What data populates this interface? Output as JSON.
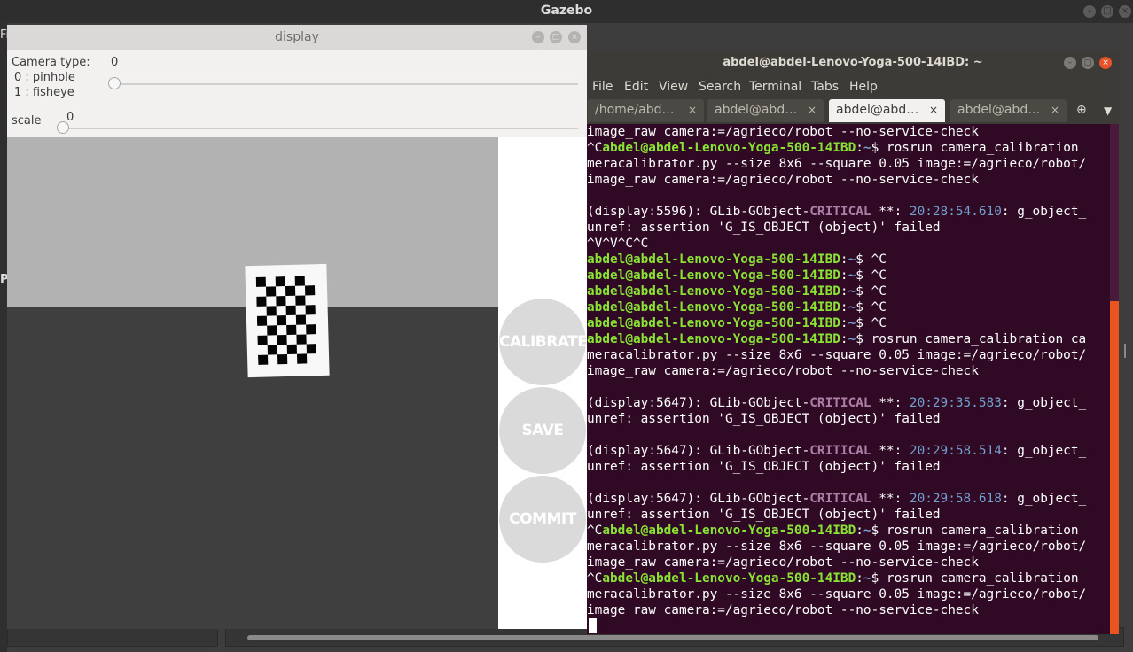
{
  "gazebo": {
    "title": "Gazebo",
    "left_letter_top": "Fi",
    "left_letter_mid": "P"
  },
  "display": {
    "title": "display",
    "camera_type_label": "Camera type:",
    "camera_type_value": "0",
    "options": [
      "0 : pinhole",
      "1 : fisheye"
    ],
    "camera_type_level": 0,
    "scale_label": "scale",
    "scale_value": "0",
    "scale_level": 0,
    "buttons": {
      "calibrate": "CALIBRATE",
      "save": "SAVE",
      "commit": "COMMIT"
    },
    "colors": {
      "sky": "#b2b2b2",
      "ground": "#3f3f3f",
      "button": "#dadada"
    }
  },
  "terminal": {
    "title": "abdel@abdel-Lenovo-Yoga-500-14IBD: ~",
    "menu": [
      "File",
      "Edit",
      "View",
      "Search",
      "Terminal",
      "Tabs",
      "Help"
    ],
    "tabs": [
      {
        "label": "/home/abd…",
        "close": "×"
      },
      {
        "label": "abdel@abd…",
        "close": "×"
      },
      {
        "label": "abdel@abd…",
        "close": "×",
        "active": true
      },
      {
        "label": "abdel@abd…",
        "close": "×"
      }
    ],
    "colors": {
      "background": "#300a24",
      "prompt": "#8ae234",
      "path": "#729fcf",
      "critical": "#ad7fa8",
      "scrollbar": "#e95420"
    },
    "lines": [
      [
        [
          "t",
          "image_raw camera:=/agrieco/robot --no-service-check"
        ]
      ],
      [
        [
          "t",
          "^C"
        ],
        [
          "g",
          "abdel@abdel-Lenovo-Yoga-500-14IBD"
        ],
        [
          "t",
          ":"
        ],
        [
          "b",
          "~"
        ],
        [
          "t",
          "$ rosrun camera_calibration "
        ]
      ],
      [
        [
          "t",
          "meracalibrator.py --size 8x6 --square 0.05 image:=/agrieco/robot/"
        ]
      ],
      [
        [
          "t",
          "image_raw camera:=/agrieco/robot --no-service-check"
        ]
      ],
      [
        [
          "t",
          ""
        ]
      ],
      [
        [
          "t",
          "(display:5596): GLib-GObject-"
        ],
        [
          "m",
          "CRITICAL"
        ],
        [
          "t",
          " **: "
        ],
        [
          "bl",
          "20:28:54.610"
        ],
        [
          "t",
          ": g_object_"
        ]
      ],
      [
        [
          "t",
          "unref: assertion 'G_IS_OBJECT (object)' failed"
        ]
      ],
      [
        [
          "t",
          "^V^V^C^C"
        ]
      ],
      [
        [
          "g",
          "abdel@abdel-Lenovo-Yoga-500-14IBD"
        ],
        [
          "t",
          ":"
        ],
        [
          "b",
          "~"
        ],
        [
          "t",
          "$ ^C"
        ]
      ],
      [
        [
          "g",
          "abdel@abdel-Lenovo-Yoga-500-14IBD"
        ],
        [
          "t",
          ":"
        ],
        [
          "b",
          "~"
        ],
        [
          "t",
          "$ ^C"
        ]
      ],
      [
        [
          "g",
          "abdel@abdel-Lenovo-Yoga-500-14IBD"
        ],
        [
          "t",
          ":"
        ],
        [
          "b",
          "~"
        ],
        [
          "t",
          "$ ^C"
        ]
      ],
      [
        [
          "g",
          "abdel@abdel-Lenovo-Yoga-500-14IBD"
        ],
        [
          "t",
          ":"
        ],
        [
          "b",
          "~"
        ],
        [
          "t",
          "$ ^C"
        ]
      ],
      [
        [
          "g",
          "abdel@abdel-Lenovo-Yoga-500-14IBD"
        ],
        [
          "t",
          ":"
        ],
        [
          "b",
          "~"
        ],
        [
          "t",
          "$ ^C"
        ]
      ],
      [
        [
          "g",
          "abdel@abdel-Lenovo-Yoga-500-14IBD"
        ],
        [
          "t",
          ":"
        ],
        [
          "b",
          "~"
        ],
        [
          "t",
          "$ rosrun camera_calibration ca"
        ]
      ],
      [
        [
          "t",
          "meracalibrator.py --size 8x6 --square 0.05 image:=/agrieco/robot/"
        ]
      ],
      [
        [
          "t",
          "image_raw camera:=/agrieco/robot --no-service-check"
        ]
      ],
      [
        [
          "t",
          ""
        ]
      ],
      [
        [
          "t",
          "(display:5647): GLib-GObject-"
        ],
        [
          "m",
          "CRITICAL"
        ],
        [
          "t",
          " **: "
        ],
        [
          "bl",
          "20:29:35.583"
        ],
        [
          "t",
          ": g_object_"
        ]
      ],
      [
        [
          "t",
          "unref: assertion 'G_IS_OBJECT (object)' failed"
        ]
      ],
      [
        [
          "t",
          ""
        ]
      ],
      [
        [
          "t",
          "(display:5647): GLib-GObject-"
        ],
        [
          "m",
          "CRITICAL"
        ],
        [
          "t",
          " **: "
        ],
        [
          "bl",
          "20:29:58.514"
        ],
        [
          "t",
          ": g_object_"
        ]
      ],
      [
        [
          "t",
          "unref: assertion 'G_IS_OBJECT (object)' failed"
        ]
      ],
      [
        [
          "t",
          ""
        ]
      ],
      [
        [
          "t",
          "(display:5647): GLib-GObject-"
        ],
        [
          "m",
          "CRITICAL"
        ],
        [
          "t",
          " **: "
        ],
        [
          "bl",
          "20:29:58.618"
        ],
        [
          "t",
          ": g_object_"
        ]
      ],
      [
        [
          "t",
          "unref: assertion 'G_IS_OBJECT (object)' failed"
        ]
      ],
      [
        [
          "t",
          "^C"
        ],
        [
          "g",
          "abdel@abdel-Lenovo-Yoga-500-14IBD"
        ],
        [
          "t",
          ":"
        ],
        [
          "b",
          "~"
        ],
        [
          "t",
          "$ rosrun camera_calibration "
        ]
      ],
      [
        [
          "t",
          "meracalibrator.py --size 8x6 --square 0.05 image:=/agrieco/robot/"
        ]
      ],
      [
        [
          "t",
          "image_raw camera:=/agrieco/robot --no-service-check"
        ]
      ],
      [
        [
          "t",
          "^C"
        ],
        [
          "g",
          "abdel@abdel-Lenovo-Yoga-500-14IBD"
        ],
        [
          "t",
          ":"
        ],
        [
          "b",
          "~"
        ],
        [
          "t",
          "$ rosrun camera_calibration "
        ]
      ],
      [
        [
          "t",
          "meracalibrator.py --size 8x6 --square 0.05 image:=/agrieco/robot/"
        ]
      ],
      [
        [
          "t",
          "image_raw camera:=/agrieco/robot --no-service-check"
        ]
      ]
    ]
  },
  "icons": {
    "window_buttons": [
      "minimize-icon",
      "maximize-icon",
      "close-icon"
    ],
    "new_tab": "new-tab-icon",
    "tab_menu": "chevron-down-icon"
  }
}
